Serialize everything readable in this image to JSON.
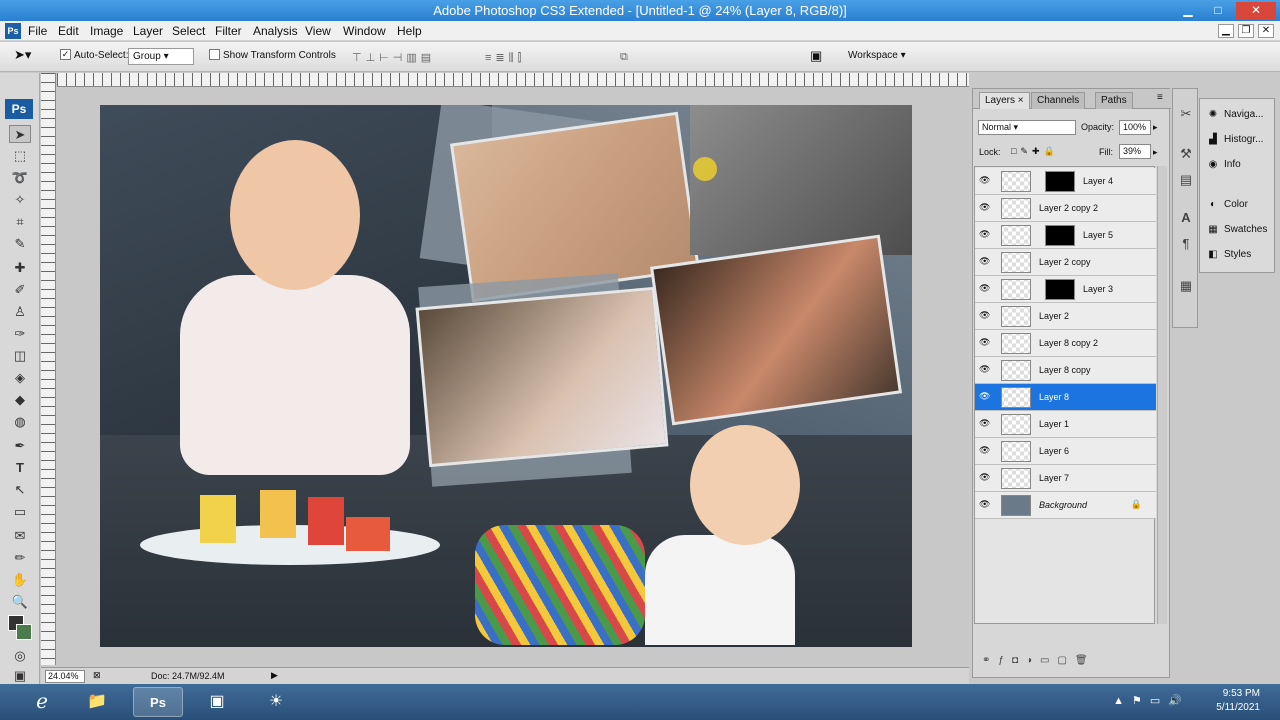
{
  "window": {
    "title": "Adobe Photoshop CS3 Extended - [Untitled-1 @ 24% (Layer 8, RGB/8)]"
  },
  "menu": [
    "File",
    "Edit",
    "Image",
    "Layer",
    "Select",
    "Filter",
    "Analysis",
    "View",
    "Window",
    "Help"
  ],
  "options": {
    "auto_select_label": "Auto-Select:",
    "auto_select_value": "Group",
    "show_transform_label": "Show Transform Controls",
    "workspace_label": "Workspace ▾"
  },
  "tools": {
    "ps_logo": "Ps"
  },
  "status": {
    "zoom": "24.04%",
    "doc": "Doc: 24.7M/92.4M"
  },
  "layers_panel": {
    "tabs": [
      "Layers ×",
      "Channels",
      "Paths"
    ],
    "blend_mode": "Normal",
    "opacity_label": "Opacity:",
    "opacity_value": "100%",
    "lock_label": "Lock:",
    "fill_label": "Fill:",
    "fill_value": "39%",
    "layers": [
      {
        "name": "Layer 4",
        "mask": true,
        "selected": false
      },
      {
        "name": "Layer 2 copy 2",
        "mask": false,
        "selected": false
      },
      {
        "name": "Layer 5",
        "mask": true,
        "selected": false
      },
      {
        "name": "Layer 2 copy",
        "mask": false,
        "selected": false
      },
      {
        "name": "Layer 3",
        "mask": true,
        "selected": false
      },
      {
        "name": "Layer 2",
        "mask": false,
        "selected": false
      },
      {
        "name": "Layer 8 copy 2",
        "mask": false,
        "selected": false
      },
      {
        "name": "Layer 8 copy",
        "mask": false,
        "selected": false
      },
      {
        "name": "Layer 8",
        "mask": false,
        "selected": true
      },
      {
        "name": "Layer 1",
        "mask": false,
        "selected": false
      },
      {
        "name": "Layer 6",
        "mask": false,
        "selected": false
      },
      {
        "name": "Layer 7",
        "mask": false,
        "selected": false
      },
      {
        "name": "Background",
        "mask": false,
        "selected": false,
        "locked": true
      }
    ]
  },
  "dock": {
    "panels": [
      {
        "label": "Naviga...",
        "icon": "navigator-icon"
      },
      {
        "label": "Histogr...",
        "icon": "histogram-icon"
      },
      {
        "label": "Info",
        "icon": "info-icon"
      },
      {
        "label": "Color",
        "icon": "color-icon"
      },
      {
        "label": "Swatches",
        "icon": "swatches-icon"
      },
      {
        "label": "Styles",
        "icon": "styles-icon"
      }
    ]
  },
  "taskbar": {
    "time": "9:53 PM",
    "date": "5/11/2021"
  },
  "colors": {
    "accent": "#1b74e0",
    "taskbar": "#2a4f78"
  }
}
